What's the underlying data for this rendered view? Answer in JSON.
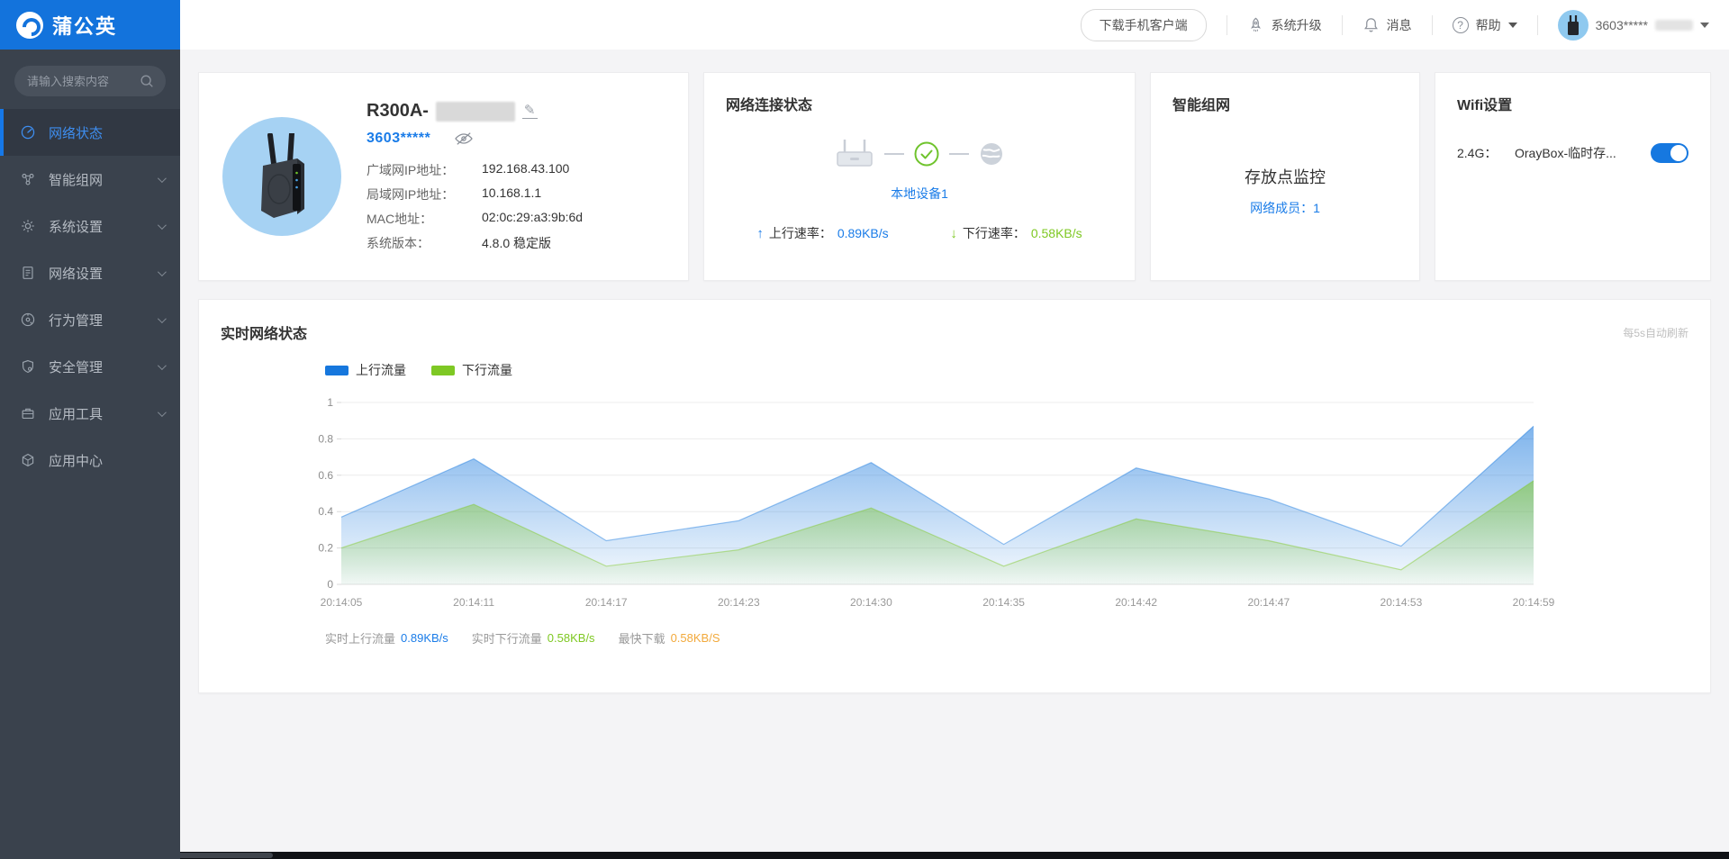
{
  "brand": {
    "name": "蒲公英"
  },
  "sidebar": {
    "search_placeholder": "请输入搜索内容",
    "items": [
      {
        "label": "网络状态",
        "icon": "dashboard-icon",
        "active": true,
        "chevron": false
      },
      {
        "label": "智能组网",
        "icon": "mesh-icon",
        "active": false,
        "chevron": true
      },
      {
        "label": "系统设置",
        "icon": "gear-icon",
        "active": false,
        "chevron": true
      },
      {
        "label": "网络设置",
        "icon": "doc-icon",
        "active": false,
        "chevron": true
      },
      {
        "label": "行为管理",
        "icon": "behavior-icon",
        "active": false,
        "chevron": true
      },
      {
        "label": "安全管理",
        "icon": "shield-icon",
        "active": false,
        "chevron": true
      },
      {
        "label": "应用工具",
        "icon": "briefcase-icon",
        "active": false,
        "chevron": true
      },
      {
        "label": "应用中心",
        "icon": "app-center-icon",
        "active": false,
        "chevron": false
      }
    ]
  },
  "header": {
    "download_app_label": "下载手机客户端",
    "upgrade_label": "系统升级",
    "messages_label": "消息",
    "help_label": "帮助",
    "account_name": "3603*****"
  },
  "device_card": {
    "model_prefix": "R300A-",
    "sn": "3603*****",
    "rows": [
      {
        "label": "广域网IP地址：",
        "value": "192.168.43.100"
      },
      {
        "label": "局域网IP地址：",
        "value": "10.168.1.1"
      },
      {
        "label": "MAC地址：",
        "value": "02:0c:29:a3:9b:6d"
      },
      {
        "label": "系统版本：",
        "value": "4.8.0 稳定版"
      }
    ]
  },
  "connection_card": {
    "title": "网络连接状态",
    "device_link": "本地设备1",
    "up_label": "上行速率：",
    "up_value": "0.89KB/s",
    "down_label": "下行速率：",
    "down_value": "0.58KB/s"
  },
  "mesh_card": {
    "title": "智能组网",
    "network_name": "存放点监控",
    "members_label": "网络成员：",
    "members_count": "1"
  },
  "wifi_card": {
    "title": "Wifi设置",
    "band_label": "2.4G：",
    "ssid": "OrayBox-临时存...",
    "enabled": true
  },
  "chart_card": {
    "title": "实时网络状态",
    "refresh_note": "每5s自动刷新",
    "stats": [
      {
        "label": "实时上行流量",
        "value": "0.89KB/s",
        "color": "#1a7ce8"
      },
      {
        "label": "实时下行流量",
        "value": "0.58KB/s",
        "color": "#7ec822"
      },
      {
        "label": "最快下载",
        "value": "0.58KB/S",
        "color": "#f2a93b"
      }
    ]
  },
  "chart_data": {
    "type": "area",
    "title": "实时网络状态",
    "x": [
      "20:14:05",
      "20:14:11",
      "20:14:17",
      "20:14:23",
      "20:14:30",
      "20:14:35",
      "20:14:42",
      "20:14:47",
      "20:14:53",
      "20:14:59"
    ],
    "series": [
      {
        "name": "上行流量",
        "color": "#1677dd",
        "values": [
          0.37,
          0.69,
          0.24,
          0.35,
          0.67,
          0.22,
          0.64,
          0.47,
          0.21,
          0.87
        ]
      },
      {
        "name": "下行流量",
        "color": "#7ec824",
        "values": [
          0.2,
          0.44,
          0.1,
          0.19,
          0.42,
          0.1,
          0.36,
          0.24,
          0.08,
          0.57
        ]
      }
    ],
    "ylim": [
      0,
      1
    ],
    "yticks": [
      0,
      0.2,
      0.4,
      0.6,
      0.8,
      1
    ],
    "grid": true,
    "legend_position": "top-left"
  },
  "colors": {
    "accent_blue": "#1373dc",
    "link_blue": "#1a7ce8",
    "up_blue": "#1a7ce8",
    "down_green": "#7ec822",
    "fastest_orange": "#f2a93b",
    "check_green": "#6fc32c"
  }
}
